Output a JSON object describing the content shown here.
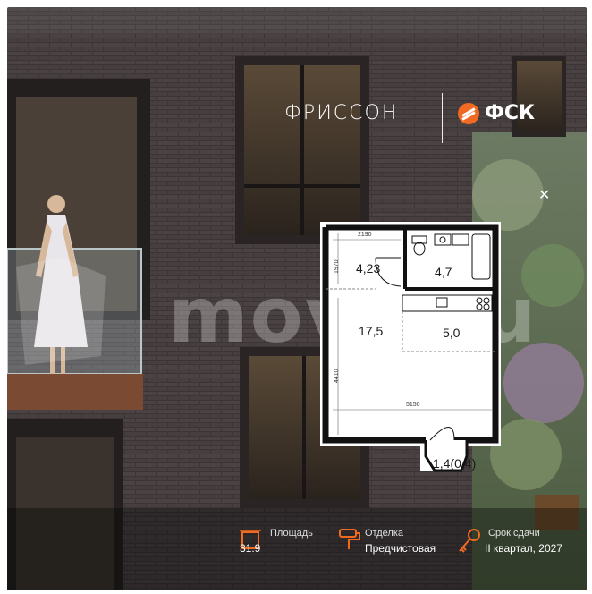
{
  "brand": {
    "left": "ФРИССОН",
    "right": "ФСК",
    "accent": "#f26a21"
  },
  "watermark": "move.ru",
  "plan": {
    "rooms": [
      {
        "id": "hall",
        "label": "4,23"
      },
      {
        "id": "bath",
        "label": "4,7"
      },
      {
        "id": "living",
        "label": "17,5"
      },
      {
        "id": "kitchen",
        "label": "5,0"
      },
      {
        "id": "balcony",
        "label": "1,4(0,4)"
      }
    ],
    "dims": {
      "top": "2190",
      "left_top": "1970",
      "left_bottom": "4410",
      "bottom": "5150"
    }
  },
  "info": {
    "area": {
      "label": "Площадь",
      "value": "31.9",
      "icon": "area-icon"
    },
    "finish": {
      "label": "Отделка",
      "value": "Предчистовая",
      "icon": "paint-roller-icon"
    },
    "deadline": {
      "label": "Срок сдачи",
      "value": "II квартал, 2027",
      "icon": "key-icon"
    }
  }
}
